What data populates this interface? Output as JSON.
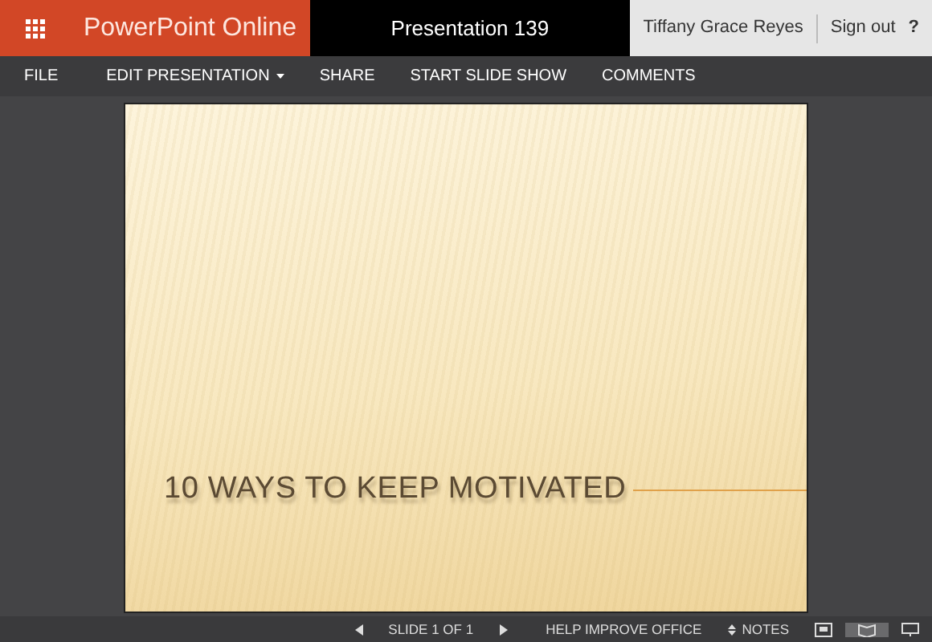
{
  "header": {
    "app_name": "PowerPoint Online",
    "document_title": "Presentation 139",
    "user_name": "Tiffany Grace Reyes",
    "sign_out": "Sign out",
    "help": "?"
  },
  "menu": [
    {
      "label": "FILE",
      "has_dropdown": false
    },
    {
      "label": "EDIT PRESENTATION",
      "has_dropdown": true
    },
    {
      "label": "SHARE",
      "has_dropdown": false
    },
    {
      "label": "START SLIDE SHOW",
      "has_dropdown": false
    },
    {
      "label": "COMMENTS",
      "has_dropdown": false
    }
  ],
  "slide": {
    "title": "10 WAYS TO KEEP MOTIVATED"
  },
  "status_bar": {
    "slide_counter": "SLIDE 1 OF 1",
    "help_improve": "HELP IMPROVE OFFICE",
    "notes": "NOTES"
  }
}
